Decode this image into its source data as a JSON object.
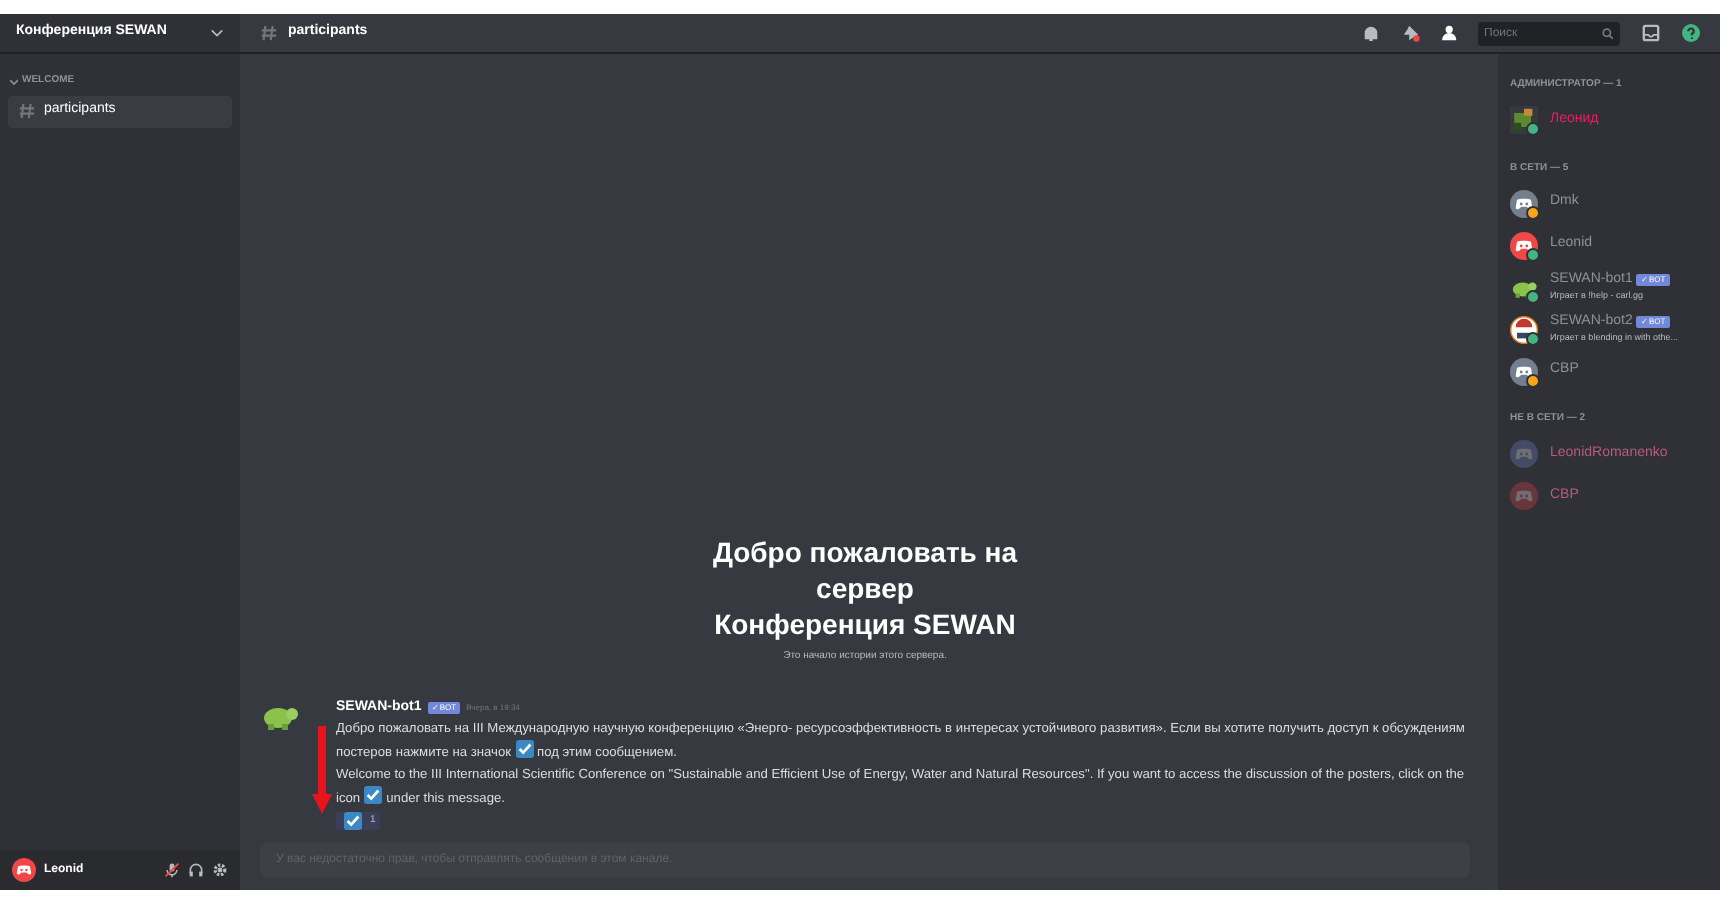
{
  "server": {
    "name": "Конференция SEWAN"
  },
  "categories": [
    {
      "name": "WELCOME",
      "expanded": true,
      "channels": [
        {
          "name": "participants",
          "selected": true
        }
      ]
    }
  ],
  "channel_header": {
    "name": "participants",
    "search": {
      "placeholder": "Поиск"
    }
  },
  "welcome": {
    "title_lines": [
      "Добро пожаловать на",
      "сервер",
      "Конференция SEWAN"
    ],
    "subtitle": "Это начало истории этого сервера."
  },
  "messages": [
    {
      "author": "SEWAN-bot1",
      "badge": "✓ BOT",
      "time": "Вчера, в 19:34",
      "paragraphs": [
        {
          "before": "Добро пожаловать на III Международную научную конференцию «Энерго- ресурсоэффективность в интересах устойчивого развития». Если вы хотите получить доступ к обсуждениям постеров нажмите на значок",
          "after": "под этим сообщением."
        },
        {
          "before": "Welcome to the III International Scientific Conference on \"Sustainable and Efficient Use of Energy, Water and Natural Resources\". If you want to access the discussion of the posters, click on the icon",
          "after": "under this message."
        }
      ],
      "reactions": [
        {
          "count": "1",
          "selected": true
        }
      ]
    }
  ],
  "composer": {
    "placeholder": "У вас недостаточно прав, чтобы отправлять сообщения в этом канале."
  },
  "user_panel": {
    "name": "Leonid",
    "muted": true
  },
  "member_groups": [
    {
      "title": "АДМИНИСТРАТОР — 1",
      "kind": "admin",
      "members": [
        {
          "name": "Леонид",
          "kind": "picture",
          "color": "#43b581"
        }
      ]
    },
    {
      "title": "В СЕТИ — 5",
      "kind": "online",
      "members": [
        {
          "name": "Dmk",
          "kind": "grey",
          "color": "#faa61a"
        },
        {
          "name": "Leonid",
          "kind": "red",
          "color": "#43b581"
        },
        {
          "name": "SEWAN-bot1",
          "kind": "turtle",
          "color": "#43b581",
          "badge": "✓ BOT",
          "activity": "Играет в !help - carl.gg"
        },
        {
          "name": "SEWAN-bot2",
          "kind": "face",
          "color": "#43b581",
          "badge": "✓ BOT",
          "activity": "Играет в blending in with othe..."
        },
        {
          "name": "CBP",
          "kind": "grey",
          "color": "#faa61a"
        }
      ]
    },
    {
      "title": "НЕ В СЕТИ — 2",
      "kind": "offline",
      "members": [
        {
          "name": "LeonidRomanenko",
          "kind": "blue"
        },
        {
          "name": "CBP",
          "kind": "red"
        }
      ]
    }
  ]
}
